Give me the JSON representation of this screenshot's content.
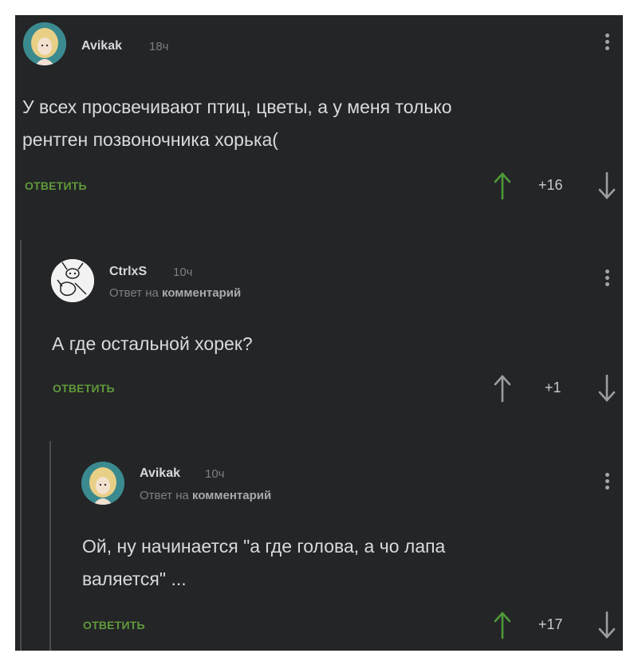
{
  "comments": [
    {
      "author": "Avikak",
      "time": "18ч",
      "reply_prefix": "",
      "reply_target": "",
      "text_lines": [
        "У всех просвечивают птиц, цветы, а у меня только",
        "рентген позвоночника хорька("
      ],
      "reply_label": "ОТВЕТИТЬ",
      "score": "+16",
      "upvoted": true,
      "avatar": "girl-avatar"
    },
    {
      "author": "CtrlxS",
      "time": "10ч",
      "reply_prefix": "Ответ на",
      "reply_target": "комментарий",
      "text_lines": [
        "А где остальной хорек?"
      ],
      "reply_label": "ОТВЕТИТЬ",
      "score": "+1",
      "upvoted": false,
      "avatar": "rabbit-avatar"
    },
    {
      "author": "Avikak",
      "time": "10ч",
      "reply_prefix": "Ответ на",
      "reply_target": "комментарий",
      "text_lines": [
        "Ой, ну начинается \"а где голова, а чо лапа",
        "валяется\" ..."
      ],
      "reply_label": "ОТВЕТИТЬ",
      "score": "+17",
      "upvoted": true,
      "avatar": "girl-avatar"
    }
  ],
  "colors": {
    "background": "#242527",
    "reply_green": "#5f9a3a",
    "upvote_green": "#4f9a3a",
    "arrow_gray": "#9c9da0",
    "avatar_teal": "#3b8a8f"
  }
}
